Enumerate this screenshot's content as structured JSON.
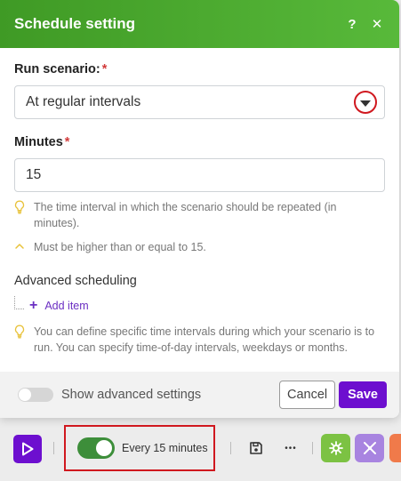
{
  "dialog": {
    "title": "Schedule setting",
    "help_icon": "?",
    "close_icon": "✕"
  },
  "run_scenario": {
    "label": "Run scenario:",
    "required_mark": "*",
    "value": "At regular intervals"
  },
  "minutes": {
    "label": "Minutes",
    "required_mark": "*",
    "value": "15",
    "hint": "The time interval in which the scenario should be repeated (in minutes).",
    "validation": "Must be higher than or equal to 15."
  },
  "advanced_scheduling": {
    "title": "Advanced scheduling",
    "add_item_label": "Add item",
    "hint": "You can define specific time intervals during which your scenario is to run. You can specify time-of-day intervals, weekdays or months."
  },
  "footer": {
    "toggle_label": "Show advanced settings",
    "cancel_label": "Cancel",
    "save_label": "Save"
  },
  "toolbar": {
    "schedule_label": "Every 15 minutes",
    "more_label": "•••"
  },
  "colors": {
    "header_green": "#4aa82e",
    "accent_purple": "#6d0fcf",
    "highlight_red": "#d0181f"
  }
}
